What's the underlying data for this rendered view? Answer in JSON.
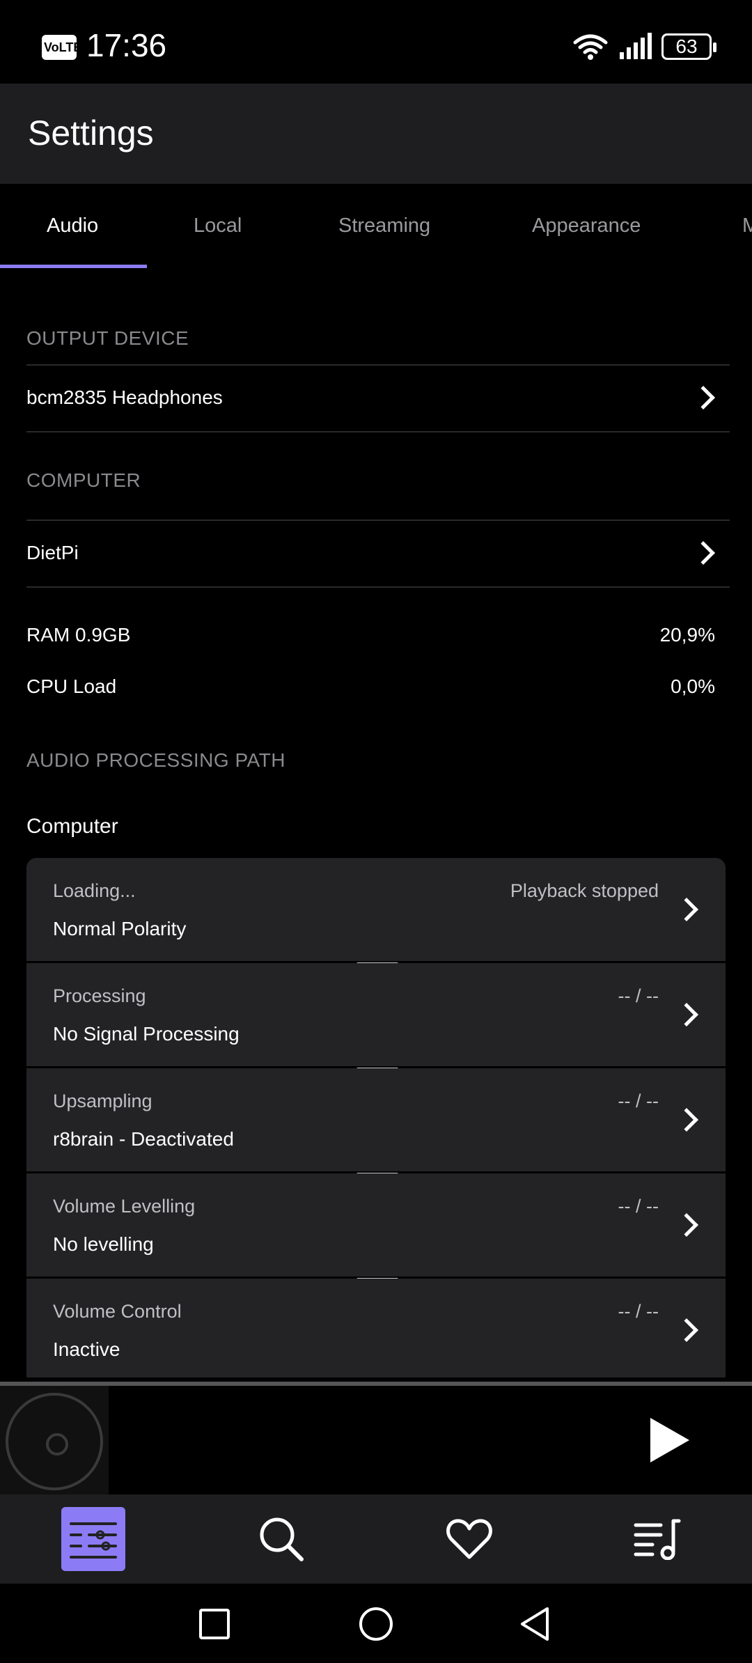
{
  "status_bar": {
    "volte": "VoLTE",
    "time": "17:36",
    "battery": "63"
  },
  "header": {
    "title": "Settings"
  },
  "tabs": [
    {
      "label": "Audio",
      "active": true
    },
    {
      "label": "Local",
      "active": false
    },
    {
      "label": "Streaming",
      "active": false
    },
    {
      "label": "Appearance",
      "active": false
    },
    {
      "label": "M",
      "active": false
    }
  ],
  "sections": {
    "output_device": {
      "label": "OUTPUT DEVICE",
      "device": "bcm2835 Headphones"
    },
    "computer": {
      "label": "COMPUTER",
      "name": "DietPi",
      "stats": [
        {
          "label": "RAM 0.9GB",
          "value": "20,9%"
        },
        {
          "label": "CPU Load",
          "value": "0,0%"
        }
      ]
    },
    "audio_processing_path": {
      "label": "AUDIO PROCESSING PATH",
      "sub_label": "Computer",
      "cards": [
        {
          "title": "Loading...",
          "value": "Normal Polarity",
          "status": "Playback stopped"
        },
        {
          "title": "Processing",
          "value": "No Signal Processing",
          "status": "-- / --"
        },
        {
          "title": "Upsampling",
          "value": "r8brain - Deactivated",
          "status": "-- / --"
        },
        {
          "title": "Volume Levelling",
          "value": "No levelling",
          "status": "-- / --"
        },
        {
          "title": "Volume Control",
          "value": "Inactive",
          "status": "-- / --"
        }
      ]
    }
  },
  "colors": {
    "accent": "#8b7cf6",
    "header_bg": "#1e1e20",
    "card_bg": "#232325"
  },
  "bottom_nav": [
    {
      "icon": "settings-sliders-icon",
      "active": true
    },
    {
      "icon": "search-icon",
      "active": false
    },
    {
      "icon": "heart-icon",
      "active": false
    },
    {
      "icon": "queue-music-icon",
      "active": false
    }
  ]
}
